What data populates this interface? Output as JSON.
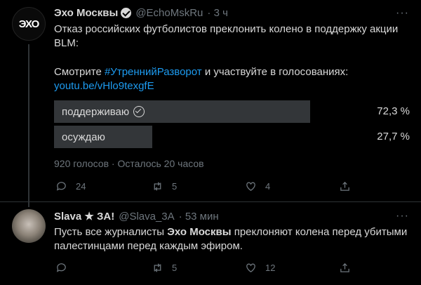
{
  "tweet1": {
    "avatar_text": "ЭХО",
    "name": "Эхо Москвы",
    "handle": "@EchoMskRu",
    "time": "· 3 ч",
    "more": "···",
    "line1": "Отказ российских футболистов преклонить колено  в поддержку акции",
    "line2": "BLM:",
    "line3_pre": "Смотрите ",
    "hashtag": "#УтреннийРазворот",
    "line3_post": " и участвуйте в голосованиях:",
    "url": "youtu.be/vHlo9texgfE",
    "poll": {
      "options": [
        {
          "label": "поддерживаю",
          "percent": "72,3 %",
          "fraction": 0.723,
          "selected": true
        },
        {
          "label": "осуждаю",
          "percent": "27,7 %",
          "fraction": 0.277,
          "selected": false
        }
      ],
      "summary": "920 голосов · Осталось 20 часов"
    },
    "actions": {
      "replies": "24",
      "retweets": "5",
      "likes": "4"
    }
  },
  "tweet2": {
    "name": "Slava ★ ЗА!",
    "handle": "@Slava_3A",
    "time": "· 53 мин",
    "more": "···",
    "text_pre": "Пусть все журналисты ",
    "text_bold": "Эхо Москвы",
    "text_post": " преклоняют колена перед убитыми",
    "line2": "палестинцами перед каждым эфиром.",
    "actions": {
      "replies": "",
      "retweets": "5",
      "likes": "12"
    }
  },
  "colors": {
    "background": "#000000",
    "link": "#1d9bf0",
    "muted": "#6e767d",
    "poll_bar": "#333639"
  }
}
